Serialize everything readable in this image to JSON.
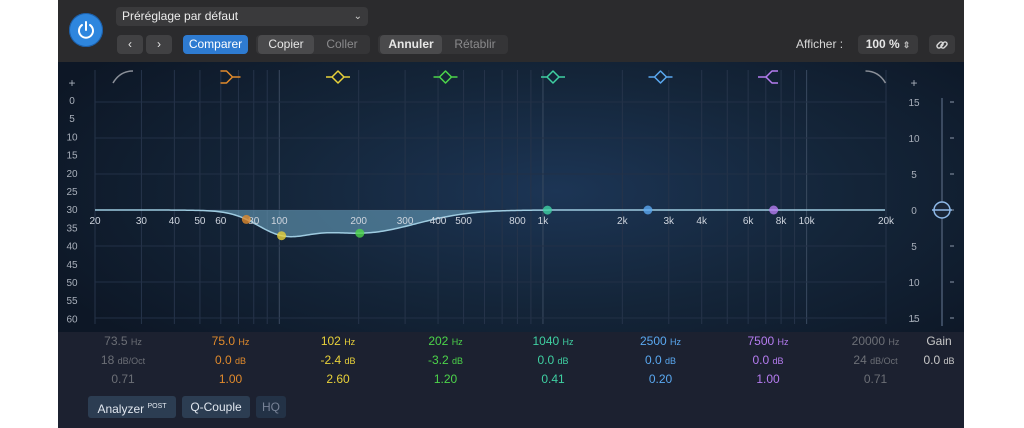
{
  "header": {
    "preset": "Préréglage par défaut",
    "prev_label": "‹",
    "next_label": "›",
    "compare_label": "Comparer",
    "copy_label": "Copier",
    "paste_label": "Coller",
    "undo_label": "Annuler",
    "redo_label": "Rétablir",
    "view_label": "Afficher :",
    "zoom_value": "100 %"
  },
  "graph": {
    "plus_label": "+",
    "minus_label": "-",
    "left_scale": [
      "0",
      "5",
      "10",
      "15",
      "20",
      "25",
      "30",
      "35",
      "40",
      "45",
      "50",
      "55",
      "60"
    ],
    "right_scale": [
      "15",
      "10",
      "5",
      "0",
      "5",
      "10",
      "15"
    ],
    "freq_labels": [
      "20",
      "30",
      "40",
      "50",
      "60",
      "80",
      "100",
      "200",
      "300",
      "400",
      "500",
      "800",
      "1k",
      "2k",
      "3k",
      "4k",
      "6k",
      "8k",
      "10k",
      "20k"
    ],
    "gain_slider_value": 0
  },
  "bands": [
    {
      "freq": "73.5",
      "freq_unit": "Hz",
      "val": "18",
      "val_unit": "dB/Oct",
      "q": "0.71",
      "color": "#6c6f76",
      "active": false,
      "icon": "low-cut-icon"
    },
    {
      "freq": "75.0",
      "freq_unit": "Hz",
      "val": "0.0",
      "val_unit": "dB",
      "q": "1.00",
      "color": "#e08a2c",
      "active": true,
      "icon": "low-shelf-icon"
    },
    {
      "freq": "102",
      "freq_unit": "Hz",
      "val": "-2.4",
      "val_unit": "dB",
      "q": "2.60",
      "color": "#e8d13a",
      "active": true,
      "icon": "bell-icon"
    },
    {
      "freq": "202",
      "freq_unit": "Hz",
      "val": "-3.2",
      "val_unit": "dB",
      "q": "1.20",
      "color": "#4cd44a",
      "active": true,
      "icon": "bell-icon"
    },
    {
      "freq": "1040",
      "freq_unit": "Hz",
      "val": "0.0",
      "val_unit": "dB",
      "q": "0.41",
      "color": "#3fd0a2",
      "active": true,
      "icon": "bell-icon"
    },
    {
      "freq": "2500",
      "freq_unit": "Hz",
      "val": "0.0",
      "val_unit": "dB",
      "q": "0.20",
      "color": "#5aa8f0",
      "active": true,
      "icon": "bell-icon"
    },
    {
      "freq": "7500",
      "freq_unit": "Hz",
      "val": "0.0",
      "val_unit": "dB",
      "q": "1.00",
      "color": "#b57cf0",
      "active": true,
      "icon": "high-shelf-icon"
    },
    {
      "freq": "20000",
      "freq_unit": "Hz",
      "val": "24",
      "val_unit": "dB/Oct",
      "q": "0.71",
      "color": "#6c6f76",
      "active": false,
      "icon": "high-cut-icon"
    }
  ],
  "gain": {
    "label": "Gain",
    "value": "0.0",
    "unit": "dB"
  },
  "footer": {
    "analyzer_label": "Analyzer",
    "analyzer_sup": "POST",
    "qcouple_label": "Q-Couple",
    "hq_label": "HQ"
  },
  "colors": {
    "accent": "#2e86de",
    "curve_fill": "#6fa9c6",
    "curve_line": "#9ecbe0"
  }
}
